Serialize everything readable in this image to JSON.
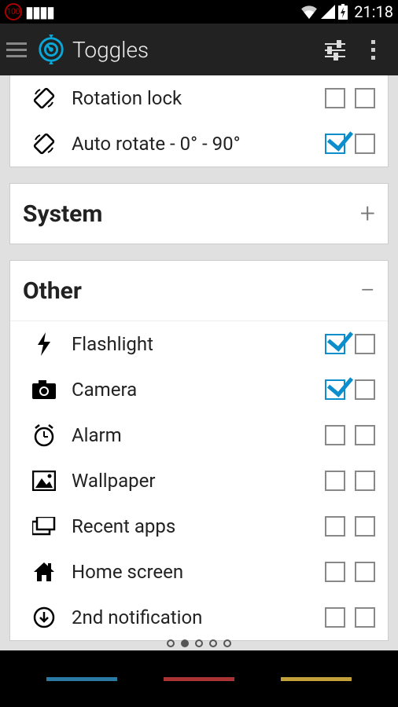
{
  "status": {
    "badge": "100",
    "time": "21:18"
  },
  "header": {
    "title": "Toggles"
  },
  "top_items": [
    {
      "label": "Rotation lock",
      "check1": false,
      "check2": false,
      "icon": "rotation"
    },
    {
      "label": "Auto rotate - 0° - 90°",
      "check1": true,
      "check2": false,
      "icon": "rotation"
    }
  ],
  "sections": [
    {
      "title": "System",
      "expanded": false
    },
    {
      "title": "Other",
      "expanded": true,
      "items": [
        {
          "label": "Flashlight",
          "check1": true,
          "check2": false,
          "icon": "flash"
        },
        {
          "label": "Camera",
          "check1": true,
          "check2": false,
          "icon": "camera"
        },
        {
          "label": "Alarm",
          "check1": false,
          "check2": false,
          "icon": "alarm"
        },
        {
          "label": "Wallpaper",
          "check1": false,
          "check2": false,
          "icon": "wallpaper"
        },
        {
          "label": "Recent apps",
          "check1": false,
          "check2": false,
          "icon": "recent"
        },
        {
          "label": "Home screen",
          "check1": false,
          "check2": false,
          "icon": "home"
        },
        {
          "label": "2nd notification",
          "check1": false,
          "check2": false,
          "icon": "notif"
        }
      ]
    }
  ],
  "pager": {
    "count": 5,
    "active": 1
  }
}
